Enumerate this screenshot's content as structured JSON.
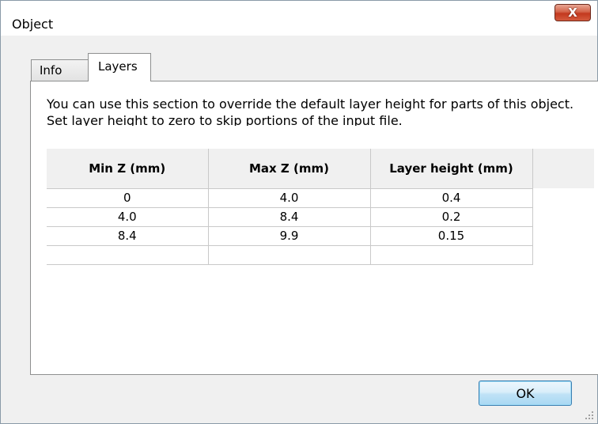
{
  "window": {
    "title": "Object",
    "close_icon": "close-icon",
    "close_glyph": "X"
  },
  "tabs": [
    {
      "label": "Info",
      "selected": false
    },
    {
      "label": "Layers",
      "selected": true
    }
  ],
  "layers_panel": {
    "description_line1": "You can use this section to override the default layer height for parts of this object.",
    "description_line2": "Set layer height to zero to skip portions of the input file."
  },
  "grid": {
    "columns": [
      "Min Z (mm)",
      "Max Z (mm)",
      "Layer height (mm)"
    ],
    "rows": [
      [
        "0",
        "4.0",
        "0.4"
      ],
      [
        "4.0",
        "8.4",
        "0.2"
      ],
      [
        "8.4",
        "9.9",
        "0.15"
      ],
      [
        "",
        "",
        ""
      ]
    ]
  },
  "buttons": {
    "ok_label": "OK"
  },
  "colors": {
    "close_button": "#c3381e",
    "ok_button": "#bfe2f6",
    "panel_background": "#f0f0f0"
  }
}
